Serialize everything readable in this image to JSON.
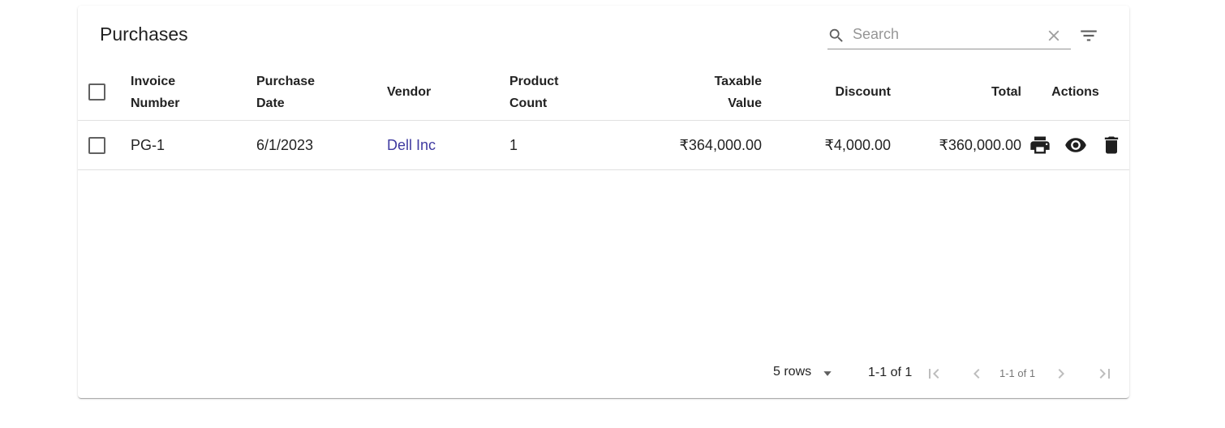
{
  "toolbar": {
    "title": "Purchases",
    "search_placeholder": "Search",
    "search_value": ""
  },
  "table": {
    "columns": [
      {
        "line1": "Invoice",
        "line2": "Number"
      },
      {
        "line1": "Purchase",
        "line2": "Date"
      },
      {
        "line1": "Vendor",
        "line2": ""
      },
      {
        "line1": "Product",
        "line2": "Count"
      },
      {
        "line1": "Taxable",
        "line2": "Value"
      },
      {
        "line1": "Discount",
        "line2": ""
      },
      {
        "line1": "Total",
        "line2": ""
      },
      {
        "line1": "Actions",
        "line2": ""
      }
    ],
    "rows": [
      {
        "invoice_number": "PG-1",
        "purchase_date": "6/1/2023",
        "vendor": "Dell Inc",
        "product_count": "1",
        "taxable_value": "₹364,000.00",
        "discount": "₹4,000.00",
        "total": "₹360,000.00"
      }
    ]
  },
  "pagination": {
    "rows_per_page": "5 rows",
    "range": "1-1 of 1",
    "small_range": "1-1 of 1"
  },
  "icons": {
    "search": "search-icon",
    "clear": "close-icon",
    "filter": "filter-list-icon",
    "print": "print-icon",
    "view": "eye-icon",
    "delete": "trash-icon",
    "first": "first-page-icon",
    "prev": "chevron-left-icon",
    "next": "chevron-right-icon",
    "last": "last-page-icon",
    "caret": "arrow-drop-down-icon"
  },
  "colors": {
    "vendor_link": "#3f3aa0",
    "icon_dark": "#1f1f1f",
    "icon_muted": "#9e9e9e"
  }
}
